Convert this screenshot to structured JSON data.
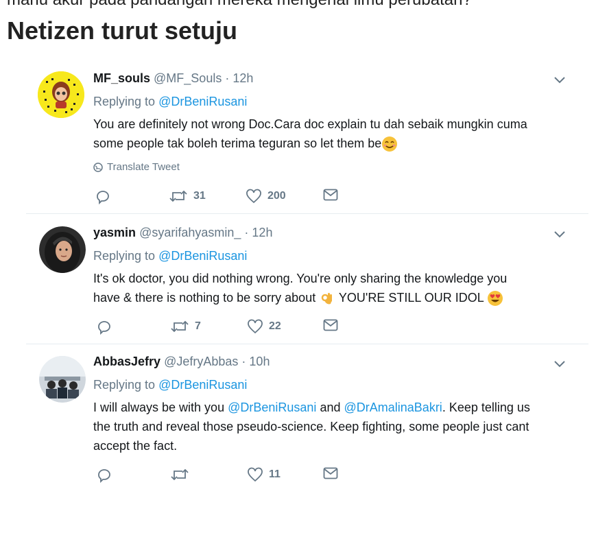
{
  "article": {
    "partial_line": "manu akur pada pandangan mereka mengenai ilmu perubatan?",
    "heading": "Netizen turut setuju"
  },
  "tweets": [
    {
      "name": "MF_souls",
      "handle": "@MF_Souls",
      "time": "12h",
      "replying_label": "Replying to",
      "replying_to": "@DrBeniRusani",
      "text_1": "You are definitely not wrong Doc.Cara doc explain tu dah sebaik mungkin cuma",
      "text_2": "some people tak boleh terima teguran so let them be",
      "translate": "Translate Tweet",
      "retweets": "31",
      "likes": "200"
    },
    {
      "name": "yasmin",
      "handle": "@syarifahyasmin_",
      "time": "12h",
      "replying_label": "Replying to",
      "replying_to": "@DrBeniRusani",
      "text_1": "It's ok doctor, you did nothing wrong. You're only sharing the knowledge you",
      "text_2a": "have & there is nothing to be sorry about",
      "text_2b": "YOU'RE STILL OUR IDOL",
      "retweets": "7",
      "likes": "22"
    },
    {
      "name": "AbbasJefry",
      "handle": "@JefryAbbas",
      "time": "10h",
      "replying_label": "Replying to",
      "replying_to": "@DrBeniRusani",
      "text_1a": "I will always be with you",
      "mention_1": "@DrBeniRusani",
      "text_1b": "and",
      "mention_2": "@DrAmalinaBakri",
      "text_1c": ". Keep telling us",
      "text_2": "the truth and reveal those pseudo-science. Keep fighting, some people just cant",
      "text_3": "accept the fact.",
      "retweets": "",
      "likes": "11"
    }
  ],
  "icons": {
    "reply": "reply-icon",
    "retweet": "retweet-icon",
    "like": "heart-icon",
    "message": "envelope-icon",
    "more": "chevron-down-icon",
    "globe": "globe-icon"
  },
  "colors": {
    "link": "#1b95e0",
    "muted": "#657786",
    "text": "#14171a"
  }
}
